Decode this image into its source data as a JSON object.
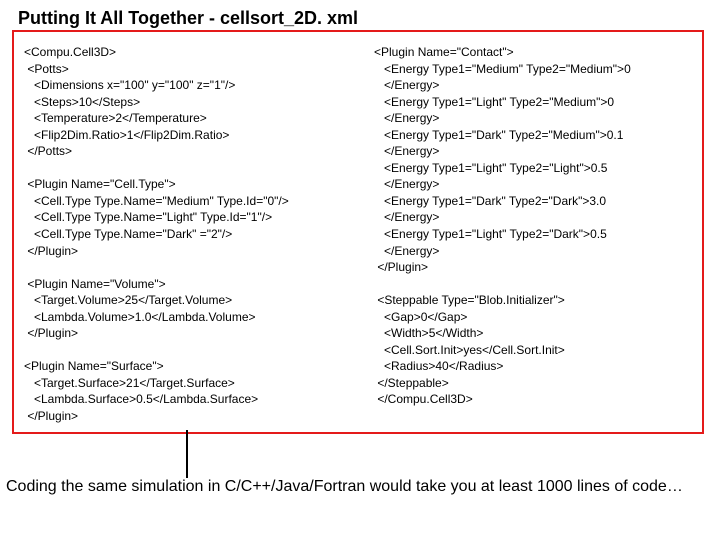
{
  "title": "Putting It All Together -  cellsort_2D. xml",
  "left_code": "<Compu.Cell3D>\n <Potts>\n   <Dimensions x=\"100\" y=\"100\" z=\"1\"/>\n   <Steps>10</Steps>\n   <Temperature>2</Temperature>\n   <Flip2Dim.Ratio>1</Flip2Dim.Ratio>\n </Potts>\n\n <Plugin Name=\"Cell.Type\">\n   <Cell.Type Type.Name=\"Medium\" Type.Id=\"0\"/>\n   <Cell.Type Type.Name=\"Light\" Type.Id=\"1\"/>\n   <Cell.Type Type.Name=\"Dark\" =\"2\"/>\n </Plugin>\n\n <Plugin Name=\"Volume\">\n   <Target.Volume>25</Target.Volume>\n   <Lambda.Volume>1.0</Lambda.Volume>\n </Plugin>\n\n<Plugin Name=\"Surface\">\n   <Target.Surface>21</Target.Surface>\n   <Lambda.Surface>0.5</Lambda.Surface>\n </Plugin>",
  "right_code": "<Plugin Name=\"Contact\">\n   <Energy Type1=\"Medium\" Type2=\"Medium\">0\n   </Energy>\n   <Energy Type1=\"Light\" Type2=\"Medium\">0\n   </Energy>\n   <Energy Type1=\"Dark\" Type2=\"Medium\">0.1\n   </Energy>\n   <Energy Type1=\"Light\" Type2=\"Light\">0.5\n   </Energy>\n   <Energy Type1=\"Dark\" Type2=\"Dark\">3.0\n   </Energy>\n   <Energy Type1=\"Light\" Type2=\"Dark\">0.5\n   </Energy>\n </Plugin>\n\n <Steppable Type=\"Blob.Initializer\">\n   <Gap>0</Gap>\n   <Width>5</Width>\n   <Cell.Sort.Init>yes</Cell.Sort.Init>\n   <Radius>40</Radius>\n </Steppable>\n </Compu.Cell3D>",
  "bottom_text": "Coding the same simulation in C/C++/Java/Fortran would take you at least 1000 lines of code…"
}
